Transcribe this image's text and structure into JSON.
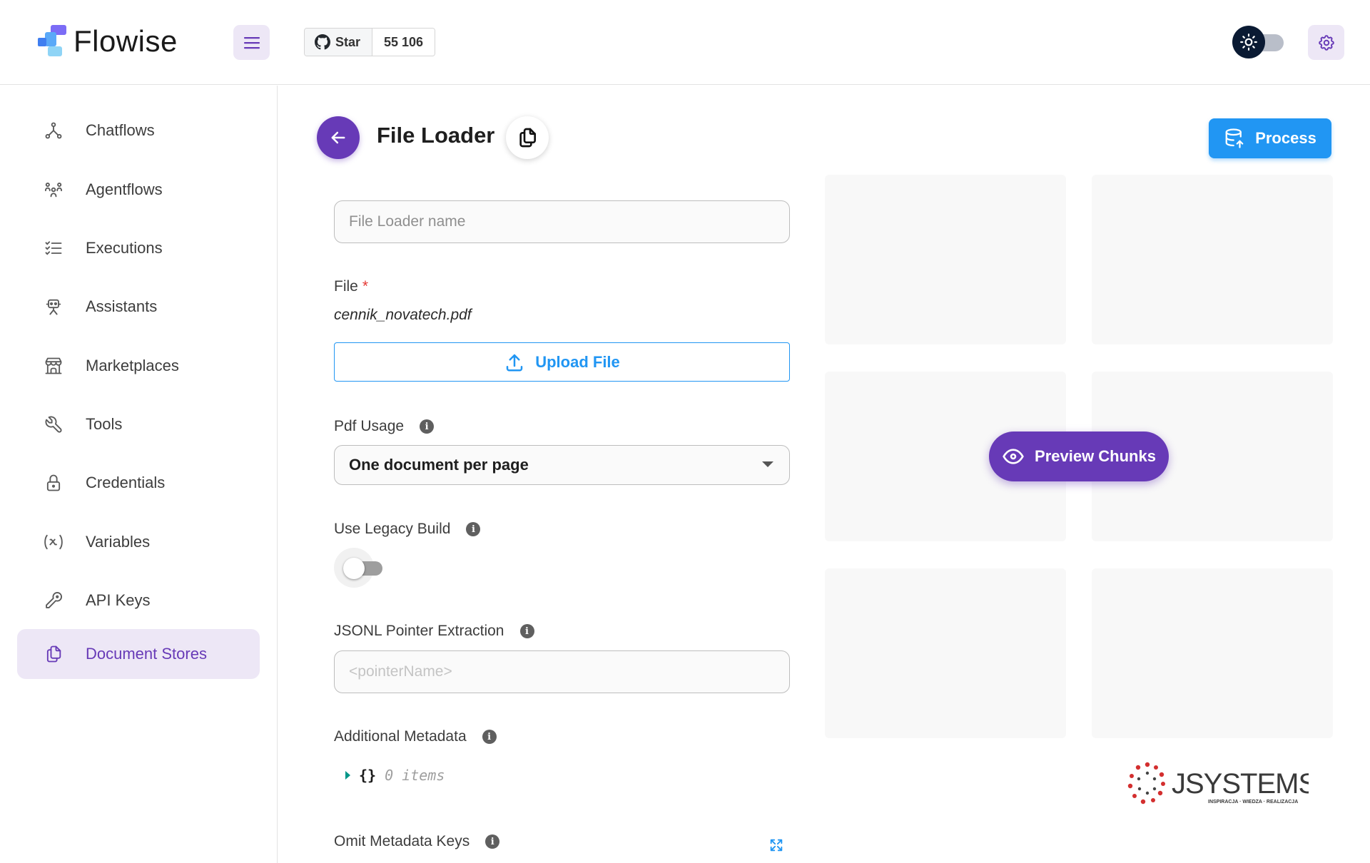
{
  "app": {
    "name": "Flowise",
    "github": {
      "star_label": "Star",
      "star_count": "55 106"
    }
  },
  "sidebar": {
    "items": [
      {
        "label": "Chatflows",
        "icon": "hierarchy-icon",
        "active": false
      },
      {
        "label": "Agentflows",
        "icon": "users-group-icon",
        "active": false
      },
      {
        "label": "Executions",
        "icon": "list-check-icon",
        "active": false
      },
      {
        "label": "Assistants",
        "icon": "robot-icon",
        "active": false
      },
      {
        "label": "Marketplaces",
        "icon": "building-store-icon",
        "active": false
      },
      {
        "label": "Tools",
        "icon": "tool-icon",
        "active": false
      },
      {
        "label": "Credentials",
        "icon": "lock-icon",
        "active": false
      },
      {
        "label": "Variables",
        "icon": "variable-icon",
        "active": false
      },
      {
        "label": "API Keys",
        "icon": "key-icon",
        "active": false
      },
      {
        "label": "Document Stores",
        "icon": "files-icon",
        "active": true
      }
    ]
  },
  "main": {
    "title": "File Loader",
    "process_label": "Process",
    "name_input": {
      "value": "",
      "placeholder": "File Loader name"
    },
    "file": {
      "label": "File",
      "required_mark": "*",
      "file_name": "cennik_novatech.pdf",
      "upload_label": "Upload File"
    },
    "pdf_usage": {
      "label": "Pdf Usage",
      "selected": "One document per page"
    },
    "legacy_build": {
      "label": "Use Legacy Build",
      "enabled": false
    },
    "jsonl_pointer": {
      "label": "JSONL Pointer Extraction",
      "placeholder": "<pointerName>"
    },
    "additional_metadata": {
      "label": "Additional Metadata",
      "braces": "{}",
      "count": "0 items"
    },
    "omit_metadata": {
      "label": "Omit Metadata Keys"
    },
    "preview_label": "Preview Chunks"
  },
  "colors": {
    "primary_purple": "#673ab7",
    "primary_light": "#ede7f6",
    "blue": "#2196f3",
    "required_red": "#e53935"
  }
}
